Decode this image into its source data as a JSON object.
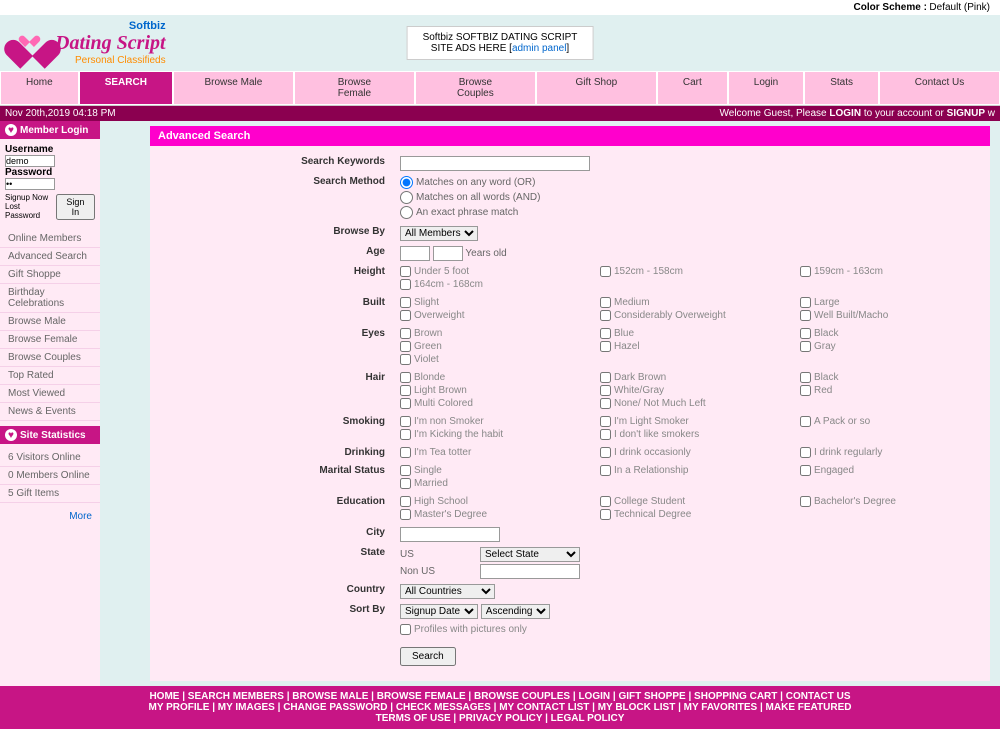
{
  "topbar": {
    "label": "Color Scheme :",
    "scheme": "Default (Pink)"
  },
  "logo": {
    "softbiz": "Softbiz",
    "dating": "Dating Script",
    "sub": "Personal Classifieds"
  },
  "ad": {
    "line1": "Softbiz SOFTBIZ DATING SCRIPT",
    "line2": "SITE ADS HERE [",
    "link": "admin panel",
    "line3": "]"
  },
  "nav": [
    "Home",
    "SEARCH",
    "Browse Male",
    "Browse Female",
    "Browse Couples",
    "Gift Shop",
    "Cart",
    "Login",
    "Stats",
    "Contact Us"
  ],
  "status": {
    "date": "Nov 20th,2019 04:18 PM",
    "welcome": "Welcome Guest, Please ",
    "login": "LOGIN",
    "mid": " to your account or ",
    "signup": "SIGNUP",
    " w": " w"
  },
  "memberLogin": {
    "title": "Member Login",
    "username": "Username",
    "usernameVal": "demo",
    "password": "Password",
    "passwordVal": "**",
    "signup": "Signup Now",
    "lost": "Lost Password",
    "signin": "Sign In"
  },
  "sideLinks": [
    "Online Members",
    "Advanced Search",
    "Gift Shoppe",
    "Birthday Celebrations",
    "Browse Male",
    "Browse Female",
    "Browse Couples",
    "Top Rated",
    "Most Viewed",
    "News & Events"
  ],
  "siteStats": {
    "title": "Site Statistics",
    "items": [
      "6 Visitors Online",
      "0 Members Online",
      "5 Gift Items"
    ],
    "more": "More"
  },
  "search": {
    "title": "Advanced Search",
    "keywords": "Search Keywords",
    "method": "Search Method",
    "methods": [
      "Matches on any word (OR)",
      "Matches on all words (AND)",
      "An exact phrase match"
    ],
    "browseBy": "Browse By",
    "browseByVal": "All Members",
    "age": "Age",
    "yearsOld": "Years old",
    "height": "Height",
    "heights": [
      [
        "Under 5 foot",
        "152cm - 158cm",
        "159cm - 163cm"
      ],
      [
        "164cm - 168cm"
      ]
    ],
    "built": "Built",
    "builts": [
      [
        "Slight",
        "Medium",
        "Large"
      ],
      [
        "Overweight",
        "Considerably Overweight",
        "Well Built/Macho"
      ]
    ],
    "eyes": "Eyes",
    "eyesOpts": [
      [
        "Brown",
        "Blue",
        "Black"
      ],
      [
        "Green",
        "Hazel",
        "Gray"
      ],
      [
        "Violet"
      ]
    ],
    "hair": "Hair",
    "hairOpts": [
      [
        "Blonde",
        "Dark Brown",
        "Black"
      ],
      [
        "Light Brown",
        "White/Gray",
        "Red"
      ],
      [
        "Multi Colored",
        "None/ Not Much Left"
      ]
    ],
    "smoking": "Smoking",
    "smokingOpts": [
      [
        "I'm non Smoker",
        "I'm Light Smoker",
        "A Pack or so"
      ],
      [
        "I'm Kicking the habit",
        "I don't like smokers"
      ]
    ],
    "drinking": "Drinking",
    "drinkingOpts": [
      [
        "I'm Tea totter",
        "I drink occasionly",
        "I drink regularly"
      ]
    ],
    "marital": "Marital Status",
    "maritalOpts": [
      [
        "Single",
        "In a Relationship",
        "Engaged"
      ],
      [
        "Married"
      ]
    ],
    "education": "Education",
    "eduOpts": [
      [
        "High School",
        "College Student",
        "Bachelor's Degree"
      ],
      [
        "Master's Degree",
        "Technical Degree"
      ]
    ],
    "city": "City",
    "state": "State",
    "us": "US",
    "stateVal": "Select State",
    "nonus": "Non US",
    "country": "Country",
    "countryVal": "All Countries",
    "sortBy": "Sort By",
    "sortByVal": "Signup Date",
    "sortDir": "Ascending",
    "pictures": "Profiles with pictures only",
    "btn": "Search"
  },
  "footer": {
    "line1": "HOME | SEARCH MEMBERS | BROWSE MALE | BROWSE FEMALE | BROWSE COUPLES | LOGIN | GIFT SHOPPE | SHOPPING CART | CONTACT US",
    "line2": "MY PROFILE | MY IMAGES | CHANGE PASSWORD | CHECK MESSAGES | MY CONTACT LIST | MY BLOCK LIST | MY FAVORITES | MAKE FEATURED",
    "line3": "TERMS OF USE | PRIVACY POLICY | LEGAL POLICY"
  }
}
